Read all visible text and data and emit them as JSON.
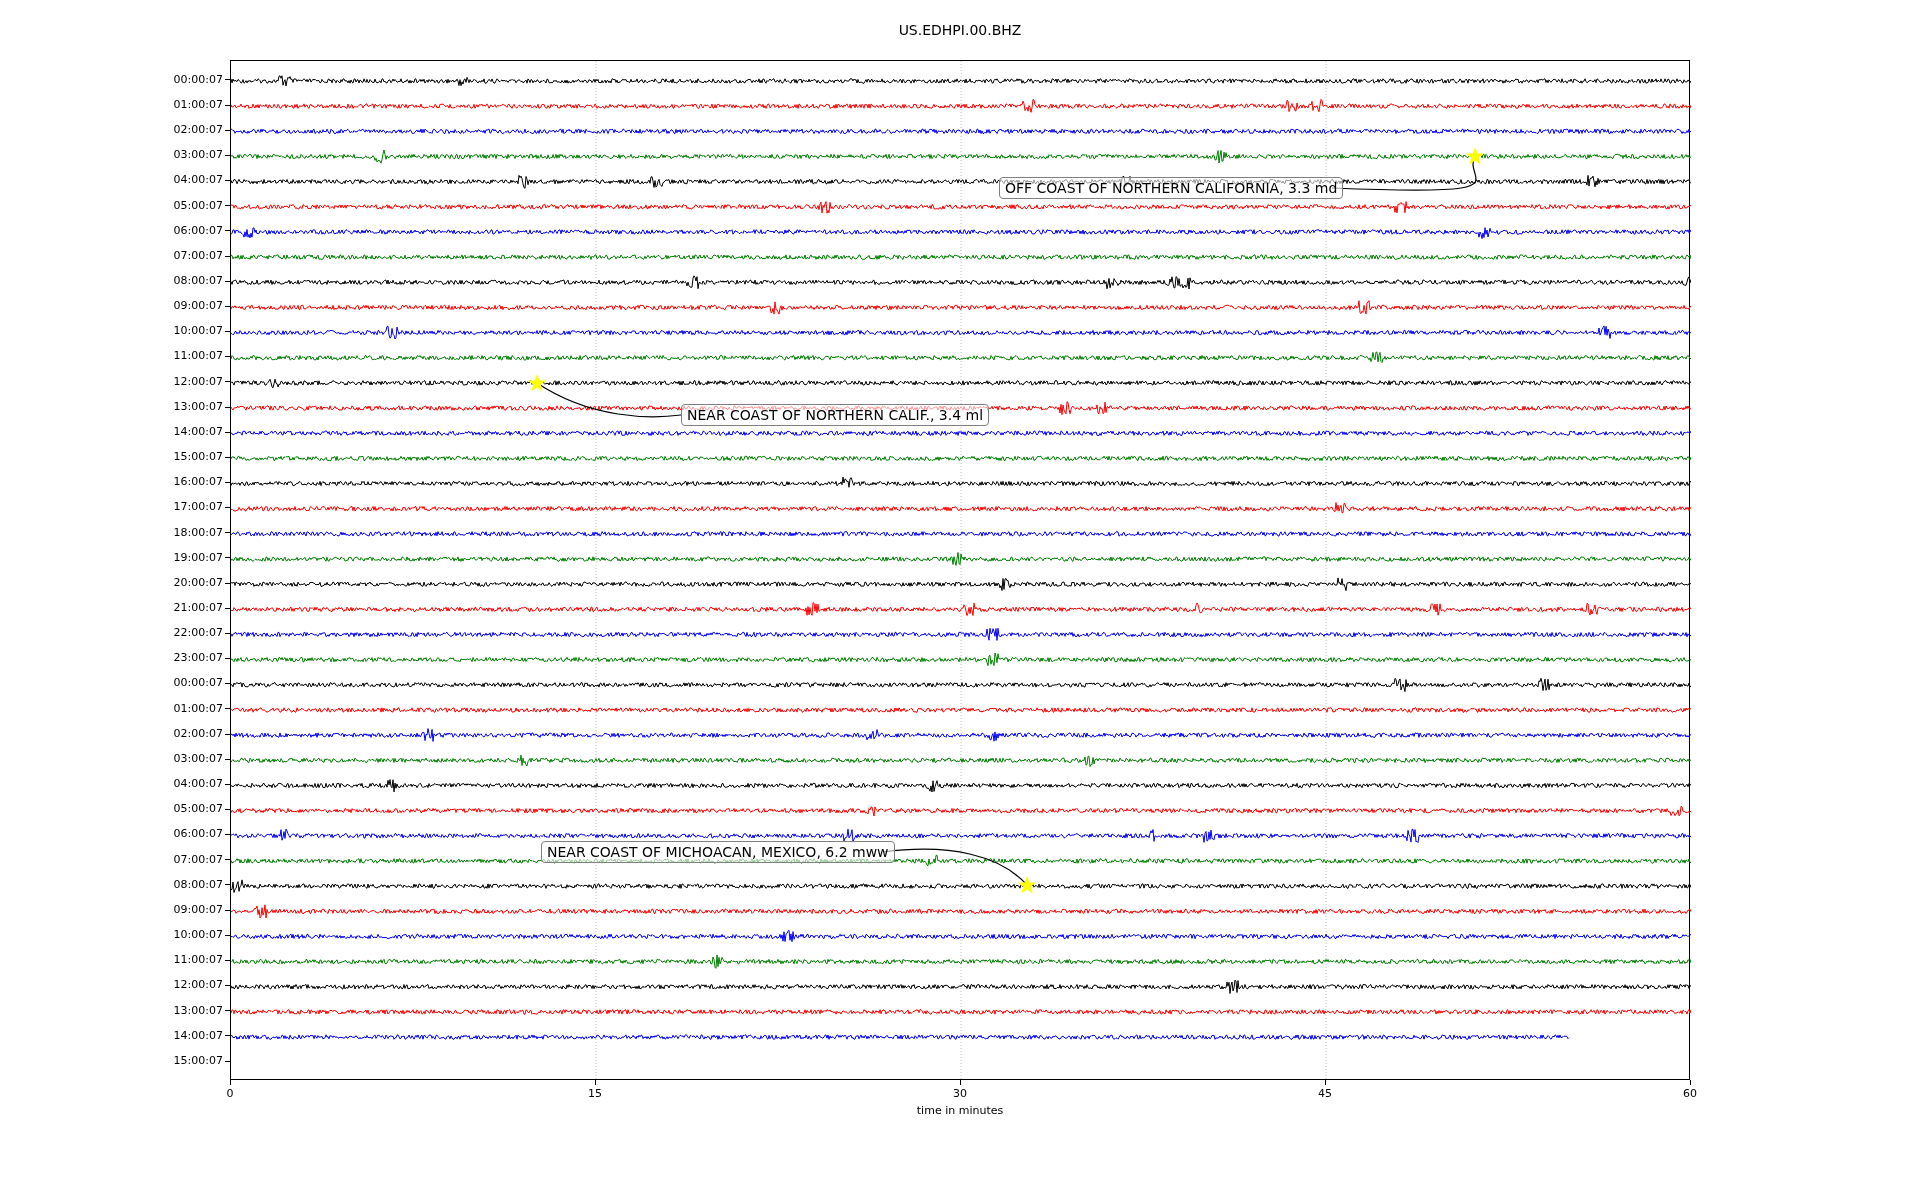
{
  "title": "US.EDHPI.00.BHZ",
  "rows": [
    {
      "label": "00:00:07",
      "color": "#000000"
    },
    {
      "label": "01:00:07",
      "color": "#ff0000"
    },
    {
      "label": "02:00:07",
      "color": "#0000ff"
    },
    {
      "label": "03:00:07",
      "color": "#008000"
    },
    {
      "label": "04:00:07",
      "color": "#000000"
    },
    {
      "label": "05:00:07",
      "color": "#ff0000"
    },
    {
      "label": "06:00:07",
      "color": "#0000ff"
    },
    {
      "label": "07:00:07",
      "color": "#008000"
    },
    {
      "label": "08:00:07",
      "color": "#000000"
    },
    {
      "label": "09:00:07",
      "color": "#ff0000"
    },
    {
      "label": "10:00:07",
      "color": "#0000ff"
    },
    {
      "label": "11:00:07",
      "color": "#008000"
    },
    {
      "label": "12:00:07",
      "color": "#000000"
    },
    {
      "label": "13:00:07",
      "color": "#ff0000"
    },
    {
      "label": "14:00:07",
      "color": "#0000ff"
    },
    {
      "label": "15:00:07",
      "color": "#008000"
    },
    {
      "label": "16:00:07",
      "color": "#000000"
    },
    {
      "label": "17:00:07",
      "color": "#ff0000"
    },
    {
      "label": "18:00:07",
      "color": "#0000ff"
    },
    {
      "label": "19:00:07",
      "color": "#008000"
    },
    {
      "label": "20:00:07",
      "color": "#000000"
    },
    {
      "label": "21:00:07",
      "color": "#ff0000"
    },
    {
      "label": "22:00:07",
      "color": "#0000ff"
    },
    {
      "label": "23:00:07",
      "color": "#008000"
    },
    {
      "label": "00:00:07",
      "color": "#000000"
    },
    {
      "label": "01:00:07",
      "color": "#ff0000"
    },
    {
      "label": "02:00:07",
      "color": "#0000ff"
    },
    {
      "label": "03:00:07",
      "color": "#008000"
    },
    {
      "label": "04:00:07",
      "color": "#000000"
    },
    {
      "label": "05:00:07",
      "color": "#ff0000"
    },
    {
      "label": "06:00:07",
      "color": "#0000ff"
    },
    {
      "label": "07:00:07",
      "color": "#008000"
    },
    {
      "label": "08:00:07",
      "color": "#000000"
    },
    {
      "label": "09:00:07",
      "color": "#ff0000"
    },
    {
      "label": "10:00:07",
      "color": "#0000ff"
    },
    {
      "label": "11:00:07",
      "color": "#008000"
    },
    {
      "label": "12:00:07",
      "color": "#000000"
    },
    {
      "label": "13:00:07",
      "color": "#ff0000"
    },
    {
      "label": "14:00:07",
      "color": "#0000ff"
    },
    {
      "label": "15:00:07"
    }
  ],
  "annotations": [
    {
      "text": "OFF COAST OF NORTHERN CALIFORNIA, 3.3 md"
    },
    {
      "text": "NEAR COAST OF NORTHERN CALIF., 3.4 ml"
    },
    {
      "text": "NEAR COAST OF MICHOACAN, MEXICO, 6.2 mww"
    }
  ],
  "xticks": [
    "0",
    "15",
    "30",
    "45",
    "60"
  ],
  "xlabel": "time in minutes"
}
